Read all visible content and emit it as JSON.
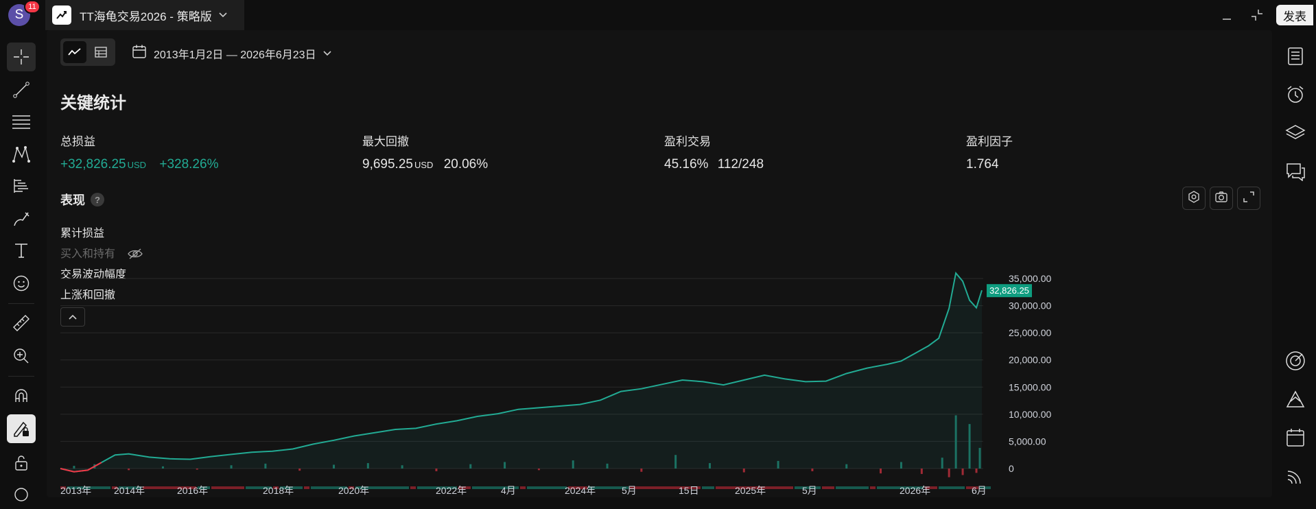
{
  "topbar": {
    "avatar_letter": "S",
    "notif_count": "11",
    "tab_title": "TT海龟交易2026 - 策略版",
    "publish_label": "发表"
  },
  "toolbar": {
    "date_range": "2013年1月2日 — 2026年6月23日"
  },
  "stats": {
    "section_title": "关键统计",
    "items": [
      {
        "label": "总损益",
        "value": "+32,826.25",
        "unit": "USD",
        "pct": "+328.26%"
      },
      {
        "label": "最大回撤",
        "value": "9,695.25",
        "unit": "USD",
        "pct": "20.06%"
      },
      {
        "label": "盈利交易",
        "value": "45.16%",
        "extra": "112/248"
      },
      {
        "label": "盈利因子",
        "value": "1.764"
      }
    ]
  },
  "performance": {
    "title": "表现",
    "help": "?",
    "legend": [
      "累计损益",
      "买入和持有",
      "交易波动幅度",
      "上涨和回撤"
    ]
  },
  "colors": {
    "accent_green": "#22ab94",
    "loss_red": "#f23645",
    "bg": "#131313"
  },
  "icons": {
    "left": [
      "crosshair-icon",
      "trendline-icon",
      "fib-icon",
      "pattern-icon",
      "forecast-icon",
      "brush-icon",
      "text-icon",
      "emoji-icon",
      "ruler-icon",
      "zoom-icon",
      "magnet-icon",
      "lock-draw-icon",
      "lock-icon"
    ],
    "right": [
      "watchlist-icon",
      "alarm-icon",
      "layers-icon",
      "chat-icon",
      "target-icon",
      "ideas-icon",
      "calendar-icon",
      "stream-icon"
    ]
  },
  "chart_data": {
    "type": "line",
    "series": [
      {
        "name": "累计损益",
        "x": [
          2013.0,
          2013.2,
          2013.4,
          2013.6,
          2013.8,
          2014.0,
          2014.3,
          2014.6,
          2014.9,
          2015.2,
          2015.5,
          2015.8,
          2016.1,
          2016.4,
          2016.7,
          2017.0,
          2017.3,
          2017.6,
          2017.9,
          2018.2,
          2018.5,
          2018.8,
          2019.1,
          2019.4,
          2019.7,
          2020.0,
          2020.3,
          2020.6,
          2020.9,
          2021.2,
          2021.5,
          2021.8,
          2022.1,
          2022.4,
          2022.7,
          2023.0,
          2023.3,
          2023.6,
          2023.9,
          2024.2,
          2024.5,
          2024.8,
          2025.1,
          2025.3,
          2025.5,
          2025.7,
          2025.85,
          2026.0,
          2026.1,
          2026.2,
          2026.3,
          2026.4,
          2026.48
        ],
        "values": [
          0,
          -600,
          -300,
          1100,
          2500,
          2700,
          2100,
          1800,
          1700,
          2200,
          2600,
          3000,
          3200,
          3600,
          4500,
          5200,
          6000,
          6600,
          7200,
          7400,
          8200,
          8800,
          9600,
          10100,
          10900,
          11200,
          11500,
          11800,
          12600,
          14200,
          14700,
          15500,
          16300,
          16000,
          15400,
          16300,
          17200,
          16500,
          16000,
          16100,
          17500,
          18500,
          19200,
          19800,
          21200,
          22600,
          24000,
          29500,
          36000,
          34500,
          31000,
          29600,
          32826.25
        ]
      },
      {
        "name": "交易波动幅度",
        "x": [
          2013.2,
          2013.5,
          2014.0,
          2014.5,
          2015.0,
          2015.5,
          2016.0,
          2016.5,
          2017.0,
          2017.5,
          2018.0,
          2018.5,
          2019.0,
          2019.5,
          2020.0,
          2020.5,
          2021.0,
          2021.5,
          2022.0,
          2022.5,
          2023.0,
          2023.5,
          2024.0,
          2024.5,
          2025.0,
          2025.3,
          2025.6,
          2025.9,
          2026.0,
          2026.1,
          2026.2,
          2026.3,
          2026.4,
          2026.45
        ],
        "values": [
          500,
          800,
          -300,
          400,
          -200,
          600,
          900,
          -400,
          700,
          1000,
          600,
          -500,
          800,
          1200,
          -300,
          1500,
          900,
          -600,
          2500,
          1000,
          -700,
          1400,
          -500,
          800,
          -900,
          1200,
          -1000,
          2000,
          -1600,
          9800,
          -1200,
          8200,
          -800,
          3800
        ]
      }
    ],
    "x_tick_labels": [
      "2013年",
      "2014年",
      "2016年",
      "2018年",
      "2020年",
      "2022年",
      "4月",
      "2024年",
      "5月",
      "15日",
      "2025年",
      "5月",
      "2026年",
      "6月"
    ],
    "y_tick_labels": [
      "35,000.00",
      "30,000.00",
      "25,000.00",
      "20,000.00",
      "15,000.00",
      "10,000.00",
      "5,000.00",
      "0"
    ],
    "last_value_label": "32,826.25",
    "ylim": [
      0,
      35000
    ]
  }
}
